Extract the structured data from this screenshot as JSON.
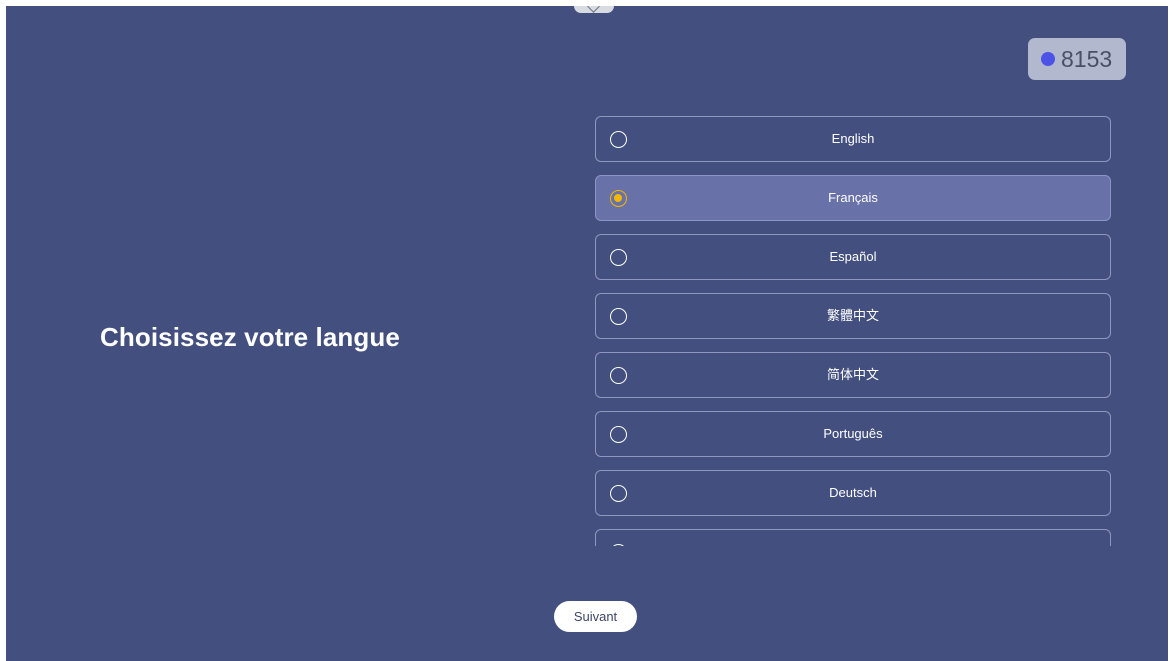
{
  "heading": "Choisissez votre langue",
  "badge": {
    "number": "8153",
    "dot_color": "#4a53e6"
  },
  "languages": [
    {
      "label": "English",
      "selected": false
    },
    {
      "label": "Français",
      "selected": true
    },
    {
      "label": "Español",
      "selected": false
    },
    {
      "label": "繁體中文",
      "selected": false
    },
    {
      "label": "简体中文",
      "selected": false
    },
    {
      "label": "Português",
      "selected": false
    },
    {
      "label": "Deutsch",
      "selected": false
    },
    {
      "label": "",
      "selected": false
    }
  ],
  "next_button": "Suivant",
  "colors": {
    "background": "#43507f",
    "selected_row": "#6871a8",
    "radio_selected": "#f5b700"
  }
}
